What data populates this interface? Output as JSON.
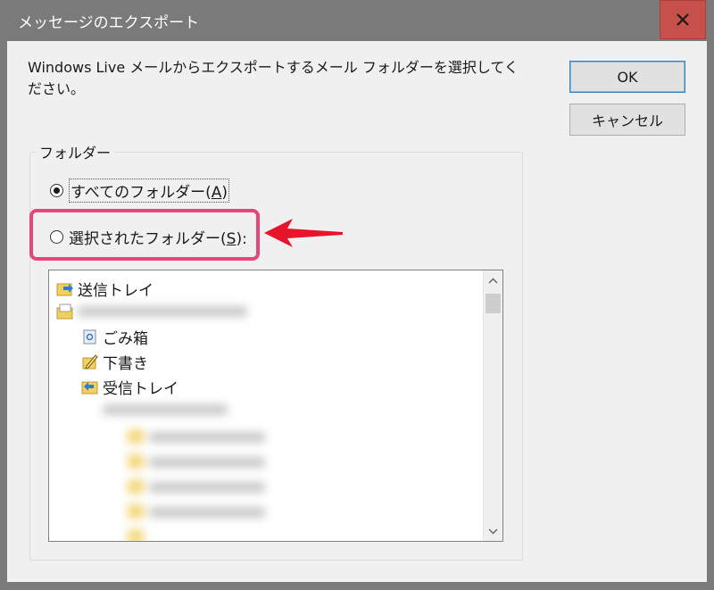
{
  "window": {
    "title": "メッセージのエクスポート"
  },
  "prompt": "Windows Live メールからエクスポートするメール フォルダーを選択してください。",
  "buttons": {
    "ok": "OK",
    "cancel": "キャンセル"
  },
  "group": {
    "label": "フォルダー",
    "all_folders": {
      "text": "すべてのフォルダー(",
      "accel": "A",
      "suffix": ")",
      "selected": true
    },
    "selected_folders": {
      "text": "選択されたフォルダー(",
      "accel": "S",
      "suffix": "):",
      "selected": false
    }
  },
  "tree": {
    "items": [
      {
        "label": "送信トレイ",
        "icon": "outbox-folder-icon"
      },
      {
        "label": "",
        "icon": "mail-account-icon"
      },
      {
        "label": "ごみ箱",
        "icon": "trash-icon"
      },
      {
        "label": "下書き",
        "icon": "drafts-icon"
      },
      {
        "label": "受信トレイ",
        "icon": "inbox-folder-icon"
      }
    ]
  },
  "colors": {
    "highlight": "#e8457a",
    "arrow": "#e8142c",
    "close": "#c7504a"
  }
}
